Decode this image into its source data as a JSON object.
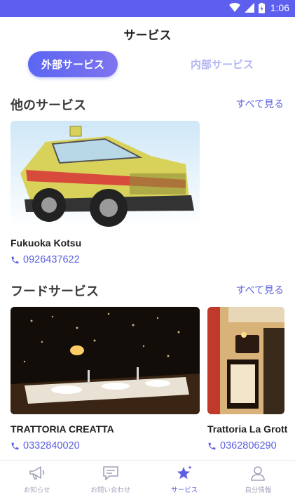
{
  "status_bar": {
    "time": "1:06"
  },
  "header": {
    "title": "サービス"
  },
  "segments": {
    "active": "外部サービス",
    "inactive": "内部サービス"
  },
  "sections": [
    {
      "title": "他のサービス",
      "see_all": "すべて見る",
      "cards": [
        {
          "name": "Fukuoka Kotsu",
          "phone": "0926437622"
        }
      ]
    },
    {
      "title": "フードサービス",
      "see_all": "すべて見る",
      "cards": [
        {
          "name": "TRATTORIA CREATTA",
          "phone": "0332840020"
        },
        {
          "name": "Trattoria La Grott",
          "phone": "0362806290"
        }
      ]
    }
  ],
  "tabbar": {
    "items": [
      {
        "label": "お知らせ",
        "icon": "megaphone-icon"
      },
      {
        "label": "お問い合わせ",
        "icon": "chat-icon"
      },
      {
        "label": "サービス",
        "icon": "star-icon"
      },
      {
        "label": "自分情報",
        "icon": "person-icon"
      }
    ]
  },
  "colors": {
    "accent": "#5D5FEF",
    "accent_text": "#5B5FE0",
    "inactive": "#A0A2BA"
  }
}
